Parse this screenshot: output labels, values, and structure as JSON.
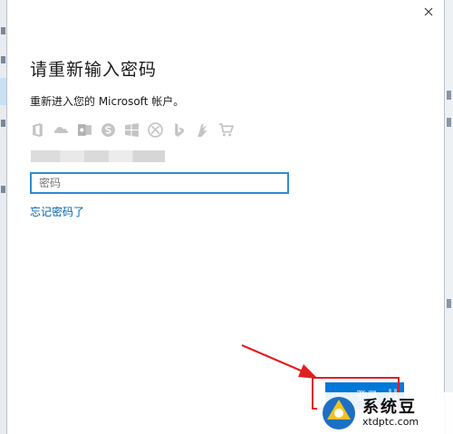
{
  "dialog": {
    "title": "请重新输入密码",
    "subtitle": "重新进入您的 Microsoft 帐户。",
    "service_icons": [
      "office-icon",
      "onedrive-icon",
      "outlook-icon",
      "skype-icon",
      "windows-icon",
      "xbox-icon",
      "bing-icon",
      "msn-icon",
      "store-icon"
    ],
    "account_name": "",
    "password": {
      "value": "",
      "placeholder": "密码"
    },
    "forgot_link": "忘记密码了",
    "signin_label": "登录"
  },
  "watermark": {
    "text": "系统豆",
    "url": "xtdptc.com"
  },
  "colors": {
    "accent": "#0078d7",
    "link": "#0063b1",
    "annotation": "#e02020",
    "focus_border": "#2f8bd6"
  }
}
